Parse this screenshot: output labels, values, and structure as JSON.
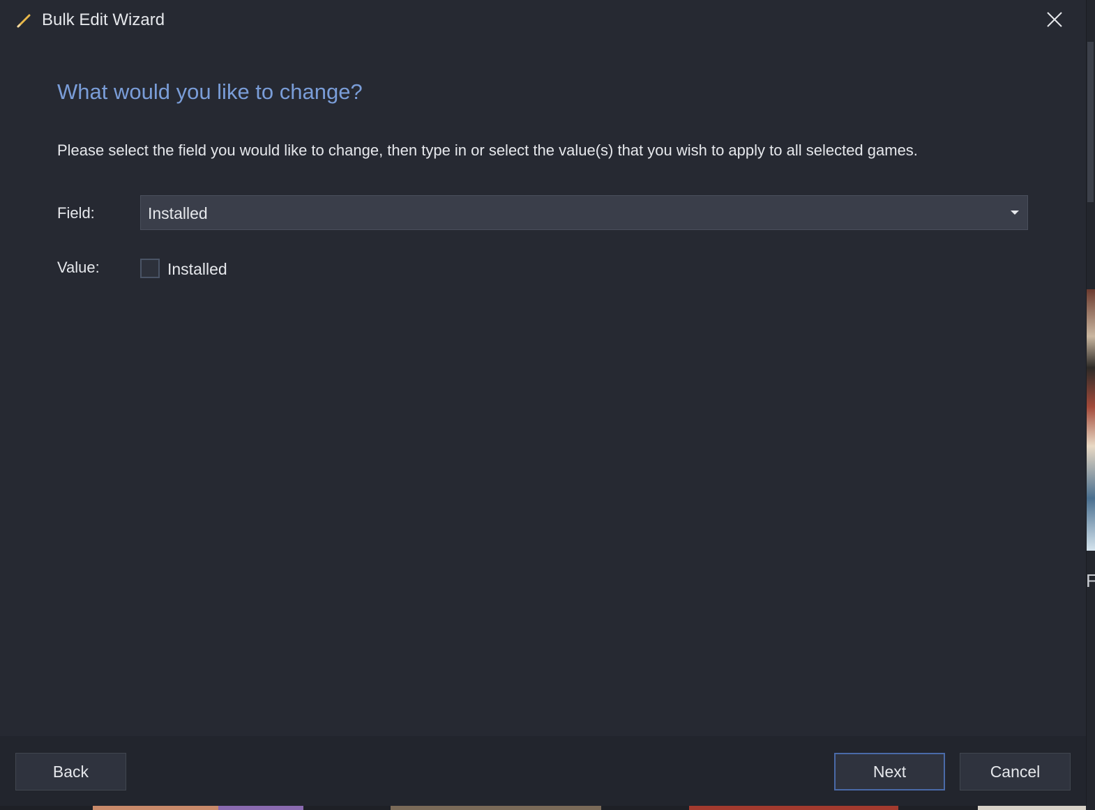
{
  "window": {
    "title": "Bulk Edit Wizard",
    "icon": "pencil-icon",
    "close_icon": "close-icon"
  },
  "content": {
    "heading": "What would you like to change?",
    "description": "Please select the field you would like to change, then type in or select the value(s) that you wish to apply to all selected games.",
    "field_label": "Field:",
    "field_selected": "Installed",
    "value_label": "Value:",
    "value_checkbox_label": "Installed",
    "value_checked": false
  },
  "footer": {
    "back_label": "Back",
    "next_label": "Next",
    "cancel_label": "Cancel"
  },
  "colors": {
    "background": "#262932",
    "heading": "#7a9dd8",
    "text": "#e6e8ec",
    "accent_border": "#4a6aa8"
  }
}
